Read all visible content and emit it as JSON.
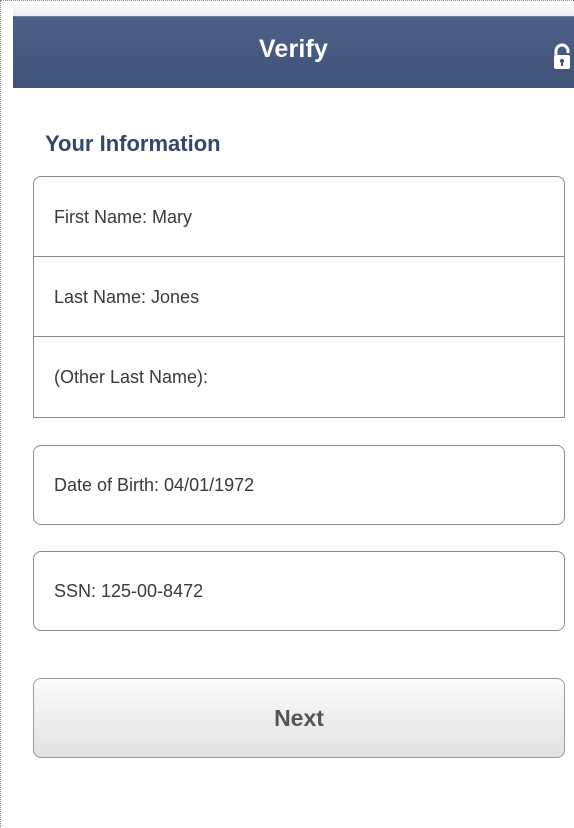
{
  "header": {
    "title": "Verify",
    "lock_icon": "lock-icon"
  },
  "section": {
    "title": "Your Information"
  },
  "fields": {
    "first_name": "First Name: Mary",
    "last_name": "Last Name:  Jones",
    "other_last_name": "(Other Last Name):",
    "date_of_birth": "Date of Birth: 04/01/1972",
    "ssn": "SSN: 125-00-8472"
  },
  "actions": {
    "next_label": "Next"
  },
  "colors": {
    "navbar": "#455984",
    "section_title": "#34466a"
  }
}
